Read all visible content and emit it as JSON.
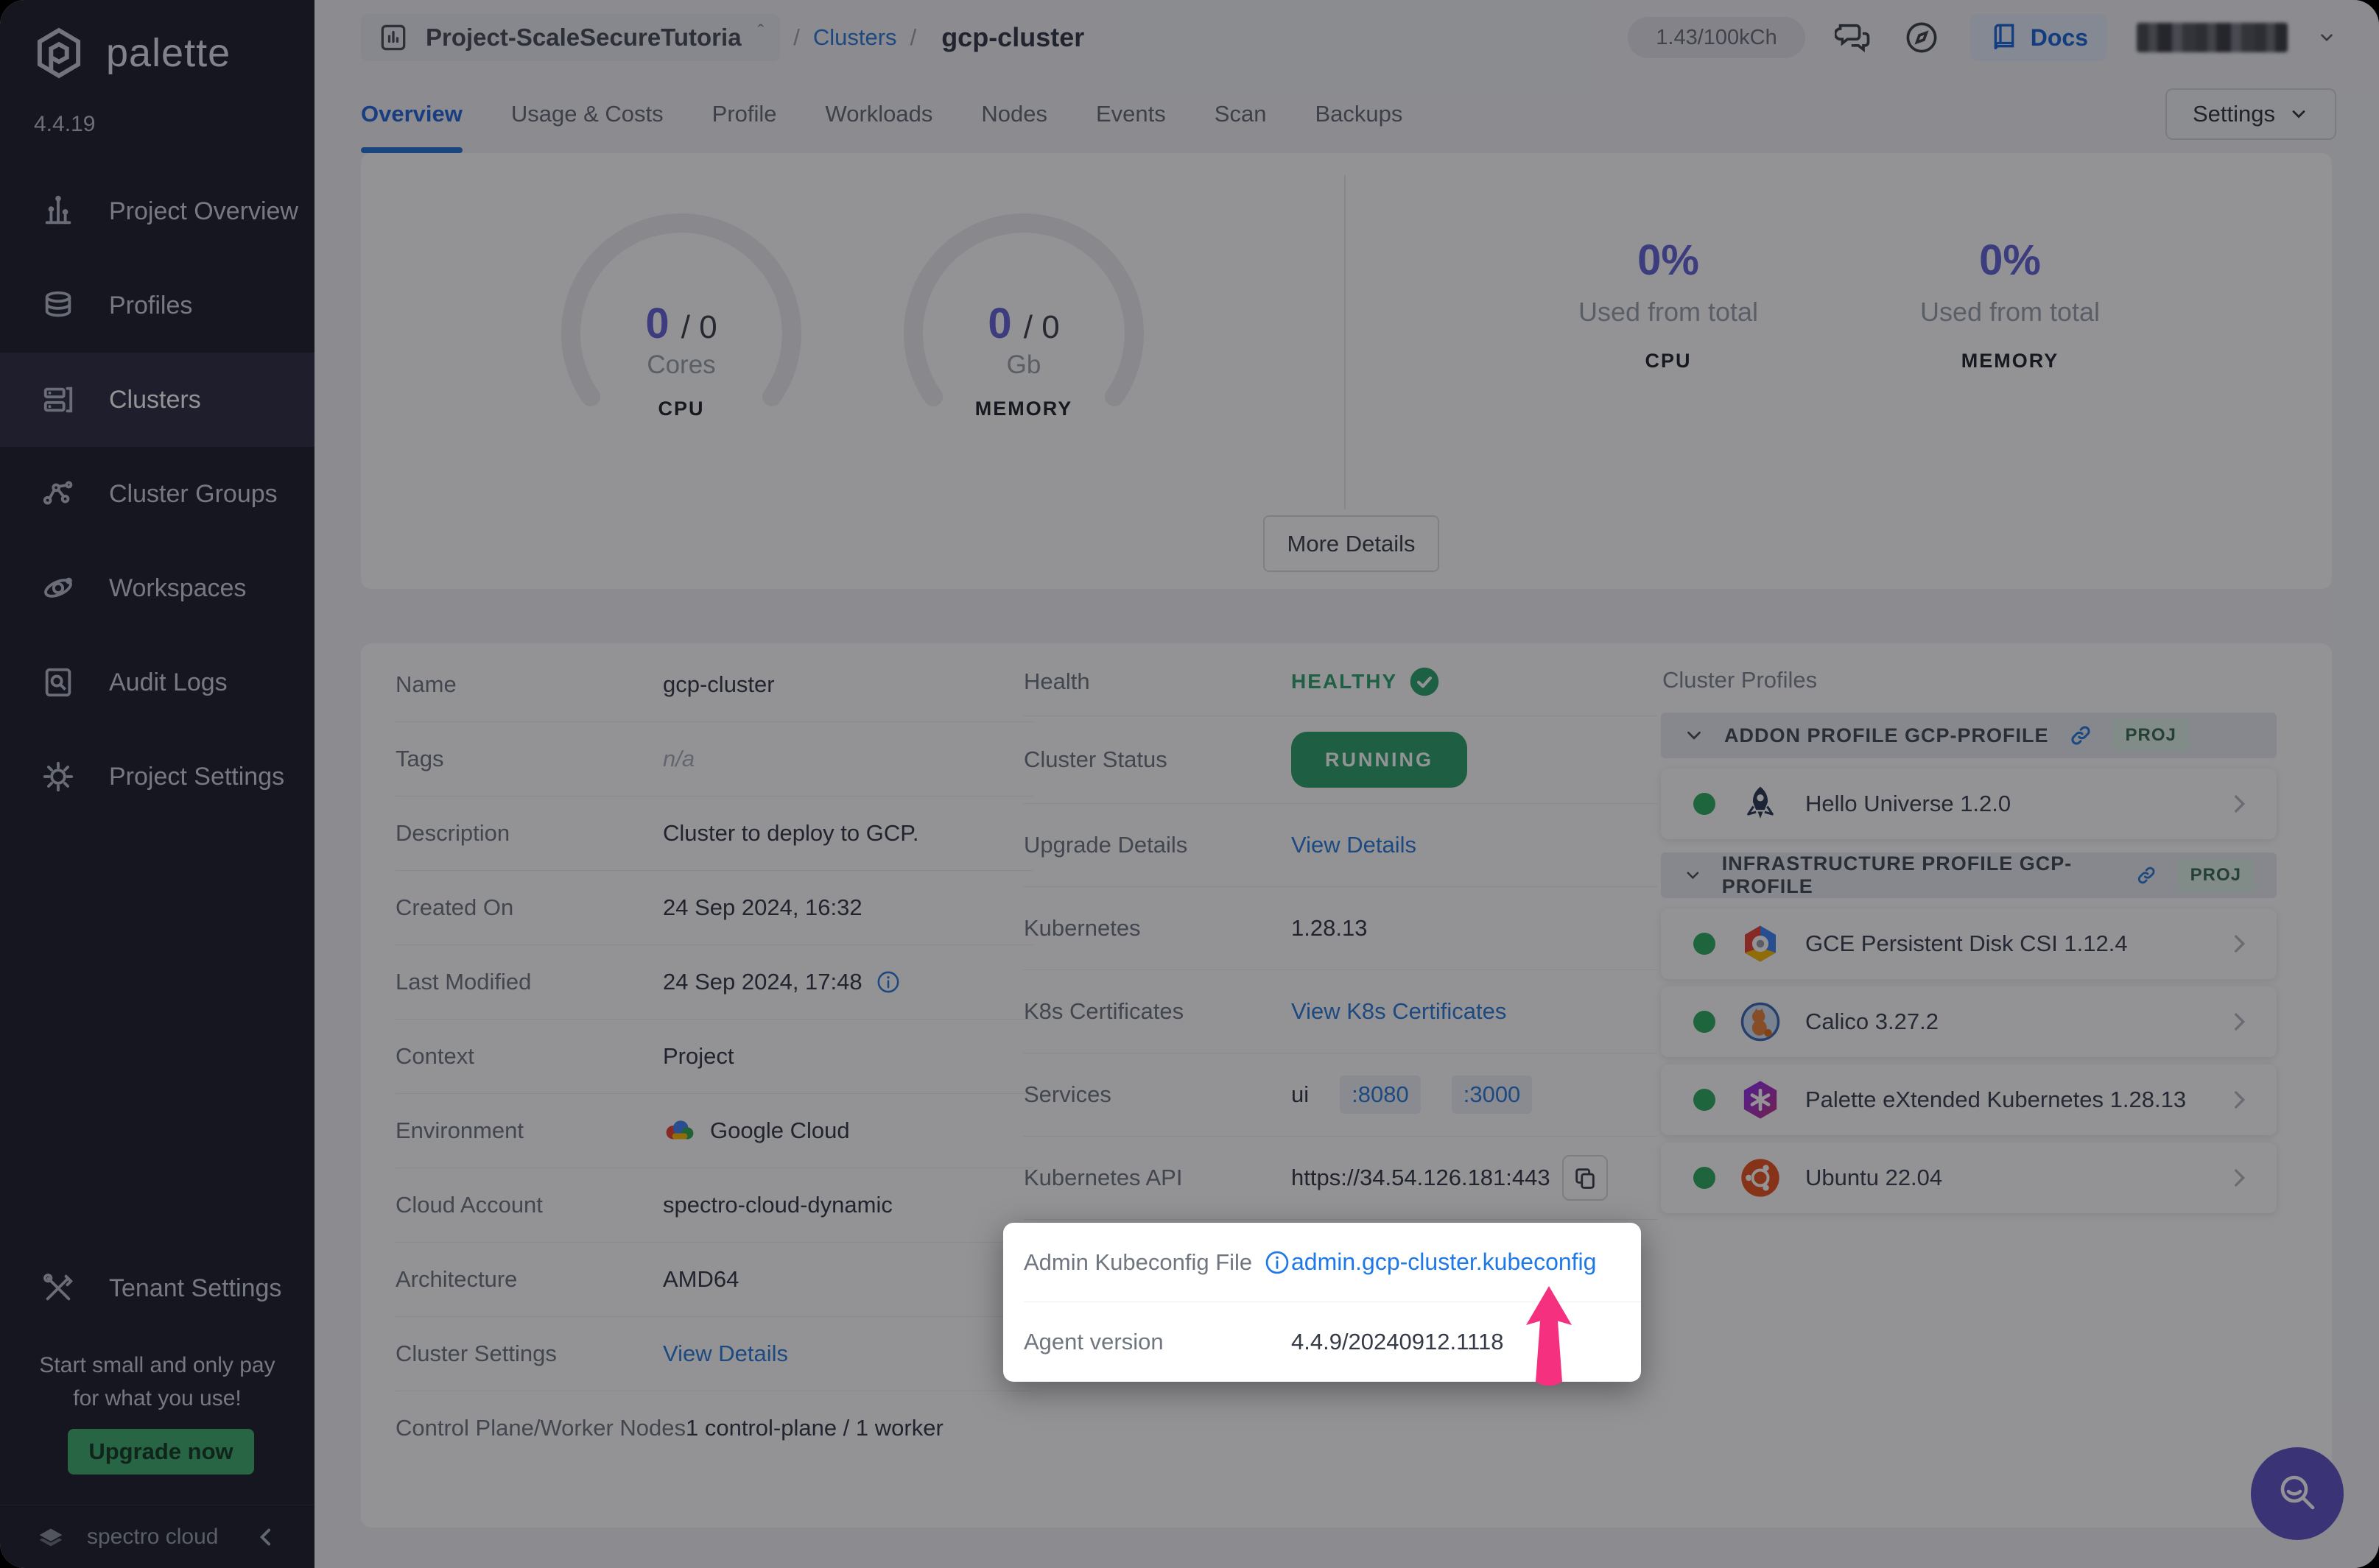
{
  "app": {
    "brand": "palette",
    "version": "4.4.19",
    "footer_brand": "spectro cloud"
  },
  "sidebar": {
    "items": [
      {
        "label": "Project Overview"
      },
      {
        "label": "Profiles"
      },
      {
        "label": "Clusters"
      },
      {
        "label": "Cluster Groups"
      },
      {
        "label": "Workspaces"
      },
      {
        "label": "Audit Logs"
      },
      {
        "label": "Project Settings"
      }
    ],
    "tenant_settings_label": "Tenant Settings",
    "promo": {
      "line1": "Start small and only pay",
      "line2": "for what you use!",
      "cta": "Upgrade now"
    }
  },
  "header": {
    "project_name": "Project-ScaleSecureTutoria",
    "sep1": "/",
    "sep2": "/",
    "breadcrumb_section": "Clusters",
    "breadcrumb_current": "gcp-cluster",
    "credits": "1.43/100kCh",
    "docs_label": "Docs"
  },
  "tabs": {
    "items": [
      "Overview",
      "Usage & Costs",
      "Profile",
      "Workloads",
      "Nodes",
      "Events",
      "Scan",
      "Backups"
    ],
    "active": "Overview",
    "settings_label": "Settings"
  },
  "usage": {
    "gauges": [
      {
        "used": "0",
        "separator": "/",
        "total": "0",
        "unit": "Cores",
        "metric": "CPU"
      },
      {
        "used": "0",
        "separator": "/",
        "total": "0",
        "unit": "Gb",
        "metric": "MEMORY"
      }
    ],
    "totals": [
      {
        "percent": "0%",
        "caption": "Used from total",
        "metric": "CPU"
      },
      {
        "percent": "0%",
        "caption": "Used from total",
        "metric": "MEMORY"
      }
    ],
    "more_details_label": "More Details"
  },
  "details": {
    "left": [
      {
        "label": "Name",
        "value": "gcp-cluster"
      },
      {
        "label": "Tags",
        "value": "n/a"
      },
      {
        "label": "Description",
        "value": "Cluster to deploy to GCP."
      },
      {
        "label": "Created On",
        "value": "24 Sep 2024, 16:32"
      },
      {
        "label": "Last Modified",
        "value": "24 Sep 2024, 17:48"
      },
      {
        "label": "Context",
        "value": "Project"
      },
      {
        "label": "Environment",
        "value": "Google Cloud"
      },
      {
        "label": "Cloud Account",
        "value": "spectro-cloud-dynamic"
      },
      {
        "label": "Architecture",
        "value": "AMD64"
      },
      {
        "label": "Cluster Settings",
        "value": "View Details"
      },
      {
        "label": "Control Plane/Worker Nodes",
        "value": "1 control-plane / 1 worker"
      }
    ],
    "right": [
      {
        "label": "Health",
        "value": "HEALTHY"
      },
      {
        "label": "Cluster Status",
        "value": "RUNNING"
      },
      {
        "label": "Upgrade Details",
        "value": "View Details"
      },
      {
        "label": "Kubernetes",
        "value": "1.28.13"
      },
      {
        "label": "K8s Certificates",
        "value": "View K8s Certificates"
      },
      {
        "label": "Services",
        "value": "ui",
        "links": [
          ":8080",
          ":3000"
        ]
      },
      {
        "label": "Kubernetes API",
        "value": "https://34.54.126.181:443"
      }
    ]
  },
  "highlight": {
    "rows": [
      {
        "label": "Admin Kubeconfig File",
        "value": "admin.gcp-cluster.kubeconfig"
      },
      {
        "label": "Agent version",
        "value": "4.4.9/20240912.1118"
      }
    ]
  },
  "cluster_profiles": {
    "title": "Cluster Profiles",
    "sections": [
      {
        "name": "ADDON PROFILE GCP-PROFILE",
        "badge": "PROJ",
        "items": [
          {
            "name": "Hello Universe 1.2.0"
          }
        ]
      },
      {
        "name": "INFRASTRUCTURE PROFILE GCP-PROFILE",
        "badge": "PROJ",
        "items": [
          {
            "name": "GCE Persistent Disk CSI 1.12.4"
          },
          {
            "name": "Calico 3.27.2"
          },
          {
            "name": "Palette eXtended Kubernetes 1.28.13"
          },
          {
            "name": "Ubuntu 22.04"
          }
        ]
      }
    ]
  },
  "colors": {
    "accent_blue": "#2e7bd9",
    "indigo": "#6665d6",
    "green": "#2fa36b",
    "pink_arrow": "#f5317f"
  }
}
